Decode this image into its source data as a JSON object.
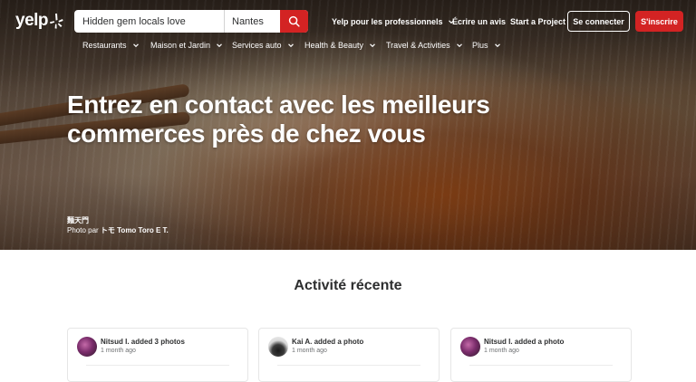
{
  "brand": {
    "name": "yelp",
    "accent": "#d32323"
  },
  "search": {
    "find_placeholder": "Hidden gem locals love",
    "near_value": "Nantes",
    "button_icon": "search-icon"
  },
  "header": {
    "business_label": "Yelp pour les professionnels",
    "review_label": "Écrire un avis",
    "project_label": "Start a Project",
    "login_label": "Se connecter",
    "signup_label": "S'inscrire"
  },
  "categories": [
    {
      "label": "Restaurants"
    },
    {
      "label": "Maison et Jardin"
    },
    {
      "label": "Services auto"
    },
    {
      "label": "Health & Beauty"
    },
    {
      "label": "Travel & Activities"
    },
    {
      "label": "Plus"
    }
  ],
  "hero": {
    "headline_line1": "Entrez en contact avec les meilleurs",
    "headline_line2": "commerces près de chez vous",
    "business_name": "麵天門",
    "photo_prefix": "Photo par ",
    "photo_author": "トモ Tomo Toro E T."
  },
  "recent": {
    "title": "Activité récente",
    "items": [
      {
        "who": "Nitsud I. added 3 photos",
        "when": "1 month ago"
      },
      {
        "who": "Kai A. added a photo",
        "when": "1 month ago"
      },
      {
        "who": "Nitsud I. added a photo",
        "when": "1 month ago"
      }
    ]
  }
}
